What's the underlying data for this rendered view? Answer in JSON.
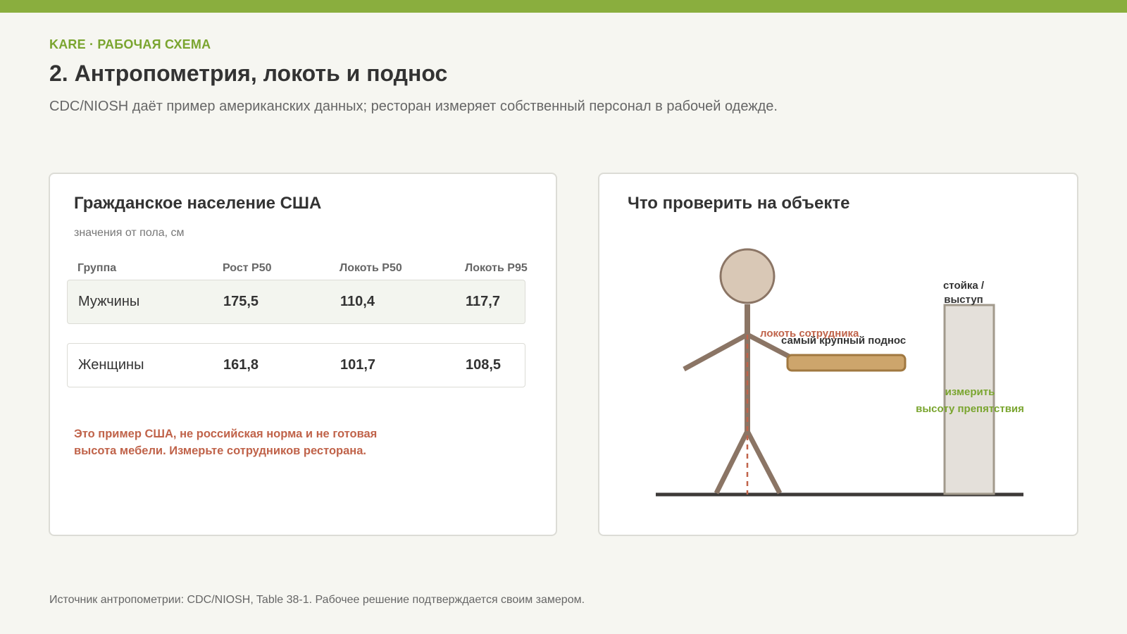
{
  "header": {
    "eyebrow": "KARE · РАБОЧАЯ СХЕМА",
    "title": "2. Антропометрия, локоть и поднос",
    "subtitle": "CDC/NIOSH даёт пример американских данных; ресторан измеряет собственный персонал в рабочей одежде."
  },
  "table_card": {
    "title": "Гражданское население США",
    "note": "значения от пола, см",
    "columns": [
      "Группа",
      "Рост P50",
      "Локоть P50",
      "Локоть P95"
    ],
    "rows": [
      {
        "group": "Мужчины",
        "height_p50": "175,5",
        "elbow_p50": "110,4",
        "elbow_p95": "117,7"
      },
      {
        "group": "Женщины",
        "height_p50": "161,8",
        "elbow_p50": "101,7",
        "elbow_p95": "108,5"
      }
    ],
    "warning_line1": "Это пример США, не российская норма и не готовая",
    "warning_line2": "высота мебели. Измерьте сотрудников ресторана."
  },
  "diagram_card": {
    "title": "Что проверить на объекте",
    "label_elbow": "локоть сотрудника",
    "label_tray": "самый крупный поднос",
    "label_counter_line1": "стойка /",
    "label_counter_line2": "выступ",
    "label_measure_line1": "измерить",
    "label_measure_line2": "высоту препятствия"
  },
  "footer": {
    "source": "Источник антропометрии: CDC/NIOSH, Table 38-1. Рабочее решение подтверждается своим замером."
  },
  "colors": {
    "accent_green": "#8aae3e",
    "warning_red": "#c0634a",
    "figure_brown": "#8b7565",
    "head_fill": "#d9c8b6",
    "tray_fill": "#cda56c",
    "counter_fill": "#e4e0da"
  }
}
